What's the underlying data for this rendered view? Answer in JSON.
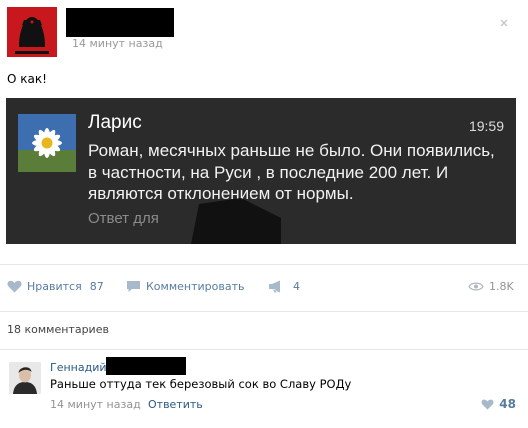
{
  "post": {
    "time": "14 минут назад",
    "text": "О как!"
  },
  "notification": {
    "sender": "Ларис",
    "time": "19:59",
    "message": "Роман, месячных раньше не было. Они появились, в частности, на Руси , в последние 200 лет. И являются отклонением от нормы.",
    "reply_hint": "Ответ для"
  },
  "actions": {
    "like_label": "Нравится",
    "like_count": "87",
    "comment_label": "Комментировать",
    "share_count": "4",
    "views": "1.8K"
  },
  "comments_count": "18 комментариев",
  "comment": {
    "author": "Геннадий",
    "text": "Раньше оттуда тек березовый сок во Славу РОДу",
    "time": "14 минут назад",
    "reply_label": "Ответить",
    "likes": "48"
  },
  "colors": {
    "link": "#2a5885",
    "action": "#577ca1",
    "notification_bg": "#2b2b2b"
  }
}
